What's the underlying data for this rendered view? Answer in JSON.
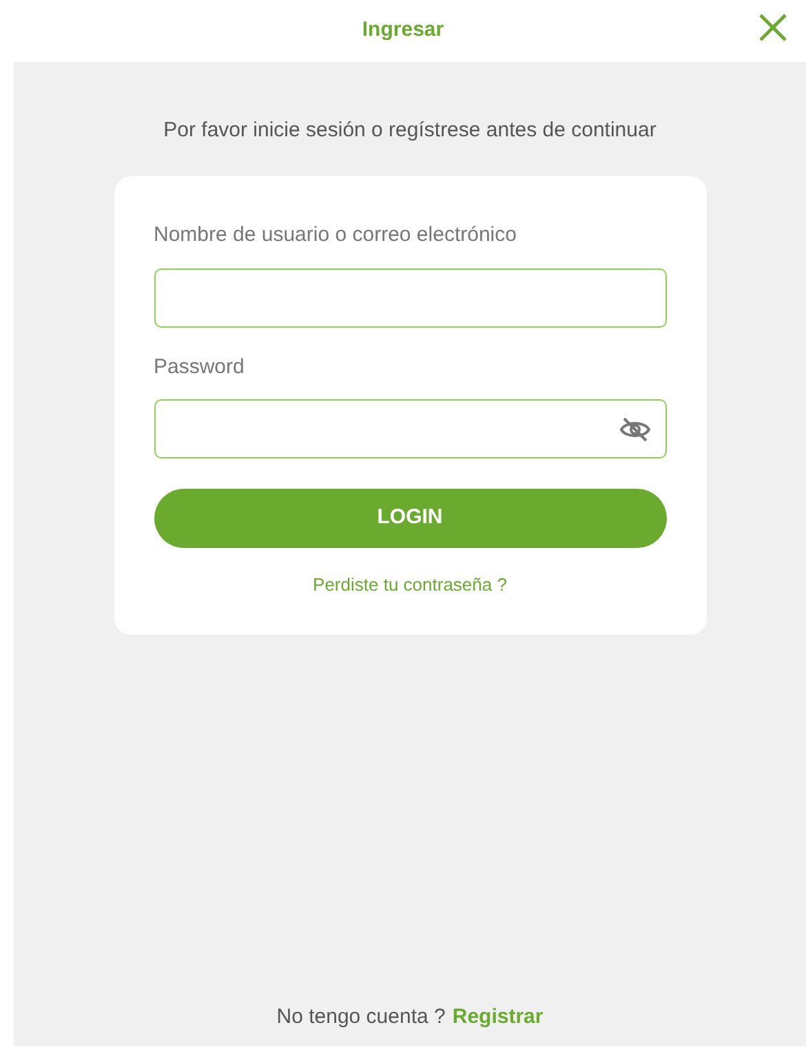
{
  "header": {
    "title": "Ingresar"
  },
  "prompt": "Por favor inicie sesión o regístrese antes de continuar",
  "form": {
    "fields": [
      {
        "label": "Nombre de usuario o correo electrónico",
        "kind": "text"
      },
      {
        "label": "Password",
        "kind": "password"
      }
    ],
    "submit": "LOGIN",
    "forgot_link": "Perdiste tu contraseña ?"
  },
  "footer": {
    "text": "No tengo cuenta ?",
    "link": "Registrar"
  }
}
